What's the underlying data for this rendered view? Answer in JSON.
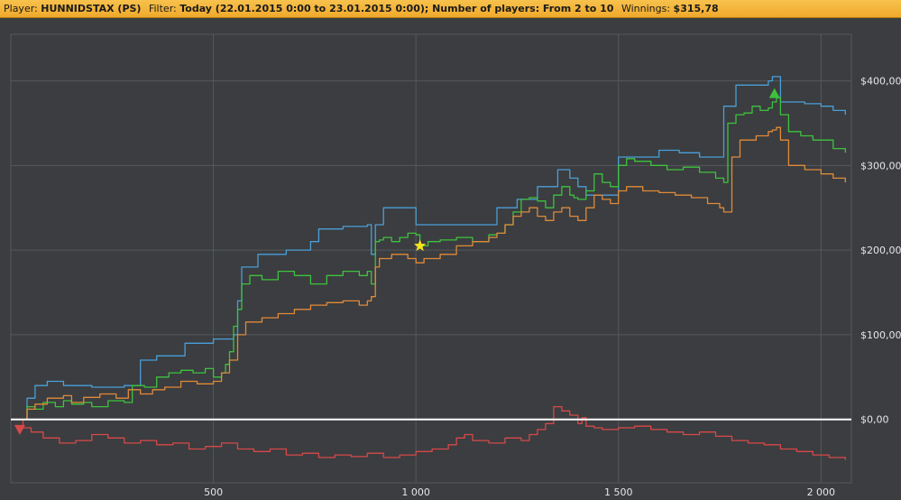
{
  "header": {
    "player_label": "Player:",
    "player_value": "HUNNIDSTAX (PS)",
    "filter_label": "Filter:",
    "filter_value": "Today (22.01.2015 0:00 to 23.01.2015 0:00); Number of players: From 2 to 10",
    "winnings_label": "Winnings:",
    "winnings_value": "$315,78"
  },
  "colors": {
    "background": "#3b3d40",
    "grid": "#55585c",
    "zero_line": "#ffffff",
    "blue": "#4a9fd8",
    "green": "#3ec23e",
    "orange": "#e08a38",
    "red": "#d84848",
    "star": "#f5e41c"
  },
  "chart_data": {
    "type": "line",
    "xlim": [
      0,
      2075
    ],
    "ylim": [
      -75,
      455
    ],
    "x_ticks": [
      500,
      1000,
      1500,
      2000
    ],
    "x_tick_labels": [
      "500",
      "1 000",
      "1 500",
      "2 000"
    ],
    "y_ticks": [
      0,
      100,
      200,
      300,
      400
    ],
    "y_tick_labels": [
      "$0,00",
      "$100,00",
      "$200,00",
      "$300,00",
      "$400,00"
    ],
    "grid": true,
    "series": [
      {
        "color": "blue",
        "x": [
          0,
          30,
          40,
          60,
          90,
          130,
          200,
          280,
          320,
          360,
          430,
          500,
          550,
          560,
          570,
          610,
          680,
          740,
          760,
          820,
          880,
          890,
          900,
          910,
          920,
          980,
          1000,
          1100,
          1200,
          1250,
          1300,
          1350,
          1380,
          1400,
          1420,
          1470,
          1500,
          1600,
          1650,
          1700,
          1750,
          1760,
          1790,
          1850,
          1870,
          1880,
          1890,
          1900,
          1960,
          2000,
          2030,
          2060
        ],
        "y": [
          0,
          0,
          25,
          40,
          45,
          40,
          38,
          40,
          70,
          75,
          90,
          95,
          100,
          140,
          180,
          195,
          200,
          210,
          225,
          228,
          230,
          195,
          230,
          230,
          250,
          250,
          230,
          230,
          250,
          260,
          275,
          295,
          285,
          275,
          265,
          265,
          310,
          318,
          315,
          310,
          310,
          370,
          395,
          395,
          400,
          405,
          405,
          375,
          373,
          370,
          365,
          360
        ]
      },
      {
        "color": "green",
        "x": [
          0,
          30,
          40,
          60,
          80,
          110,
          130,
          150,
          180,
          200,
          240,
          280,
          300,
          330,
          360,
          390,
          420,
          450,
          480,
          500,
          520,
          530,
          540,
          550,
          560,
          570,
          590,
          620,
          660,
          700,
          740,
          780,
          820,
          860,
          880,
          890,
          900,
          910,
          920,
          940,
          960,
          980,
          1000,
          1010,
          1030,
          1060,
          1100,
          1140,
          1180,
          1200,
          1220,
          1240,
          1260,
          1280,
          1300,
          1320,
          1340,
          1360,
          1380,
          1390,
          1400,
          1420,
          1440,
          1460,
          1480,
          1500,
          1520,
          1540,
          1580,
          1620,
          1660,
          1700,
          1740,
          1760,
          1770,
          1790,
          1810,
          1830,
          1850,
          1870,
          1880,
          1890,
          1900,
          1920,
          1950,
          1980,
          2000,
          2030,
          2060
        ],
        "y": [
          0,
          0,
          15,
          12,
          20,
          15,
          22,
          18,
          20,
          15,
          22,
          20,
          40,
          38,
          50,
          55,
          58,
          55,
          60,
          50,
          55,
          65,
          80,
          110,
          130,
          160,
          170,
          165,
          175,
          170,
          160,
          170,
          175,
          170,
          175,
          160,
          210,
          212,
          215,
          210,
          215,
          220,
          218,
          205,
          210,
          212,
          215,
          210,
          218,
          220,
          230,
          245,
          260,
          262,
          258,
          250,
          265,
          275,
          265,
          262,
          260,
          270,
          290,
          280,
          275,
          300,
          308,
          305,
          300,
          295,
          298,
          292,
          285,
          280,
          350,
          360,
          362,
          370,
          365,
          368,
          375,
          380,
          360,
          340,
          335,
          330,
          330,
          320,
          315
        ]
      },
      {
        "color": "orange",
        "x": [
          0,
          30,
          40,
          60,
          90,
          130,
          150,
          180,
          220,
          260,
          290,
          320,
          350,
          380,
          420,
          460,
          500,
          520,
          540,
          560,
          580,
          620,
          660,
          700,
          740,
          780,
          820,
          860,
          880,
          890,
          900,
          910,
          940,
          980,
          1000,
          1020,
          1060,
          1100,
          1140,
          1180,
          1200,
          1220,
          1240,
          1260,
          1280,
          1300,
          1320,
          1340,
          1360,
          1380,
          1400,
          1420,
          1440,
          1460,
          1480,
          1500,
          1520,
          1560,
          1600,
          1640,
          1680,
          1720,
          1750,
          1760,
          1780,
          1800,
          1840,
          1870,
          1880,
          1890,
          1900,
          1920,
          1960,
          2000,
          2030,
          2060
        ],
        "y": [
          0,
          0,
          12,
          18,
          25,
          28,
          20,
          26,
          30,
          25,
          35,
          30,
          35,
          38,
          45,
          42,
          45,
          55,
          70,
          100,
          115,
          120,
          125,
          130,
          135,
          138,
          140,
          135,
          140,
          145,
          180,
          190,
          195,
          190,
          185,
          190,
          195,
          205,
          210,
          215,
          220,
          230,
          240,
          245,
          250,
          240,
          235,
          245,
          250,
          240,
          235,
          250,
          265,
          260,
          255,
          270,
          275,
          270,
          268,
          265,
          262,
          255,
          250,
          245,
          310,
          330,
          335,
          340,
          342,
          345,
          330,
          300,
          295,
          290,
          285,
          280
        ]
      },
      {
        "color": "red",
        "x": [
          0,
          30,
          50,
          80,
          120,
          160,
          200,
          240,
          280,
          320,
          360,
          400,
          440,
          480,
          520,
          560,
          600,
          640,
          680,
          720,
          760,
          800,
          840,
          880,
          920,
          960,
          1000,
          1040,
          1080,
          1100,
          1120,
          1140,
          1180,
          1220,
          1260,
          1280,
          1300,
          1320,
          1340,
          1360,
          1380,
          1400,
          1410,
          1420,
          1440,
          1460,
          1500,
          1540,
          1580,
          1620,
          1660,
          1700,
          1740,
          1780,
          1820,
          1860,
          1900,
          1940,
          1980,
          2020,
          2060
        ],
        "y": [
          0,
          -10,
          -15,
          -22,
          -28,
          -25,
          -18,
          -22,
          -28,
          -25,
          -30,
          -28,
          -35,
          -32,
          -28,
          -35,
          -38,
          -35,
          -42,
          -40,
          -45,
          -42,
          -44,
          -40,
          -45,
          -42,
          -38,
          -35,
          -30,
          -22,
          -18,
          -25,
          -28,
          -22,
          -25,
          -18,
          -12,
          -5,
          15,
          10,
          5,
          -5,
          2,
          -8,
          -10,
          -12,
          -10,
          -8,
          -12,
          -15,
          -18,
          -15,
          -20,
          -25,
          -28,
          -30,
          -35,
          -38,
          -42,
          -45,
          -48
        ]
      },
      {
        "color": "zero_line",
        "x": [
          0,
          2075
        ],
        "y": [
          0,
          0
        ]
      }
    ],
    "markers": [
      {
        "shape": "triangle-down",
        "color": "red",
        "x": 22,
        "y": -12
      },
      {
        "shape": "star",
        "color": "star",
        "x": 1010,
        "y": 205
      },
      {
        "shape": "triangle-up",
        "color": "green",
        "x": 1885,
        "y": 385
      }
    ]
  }
}
